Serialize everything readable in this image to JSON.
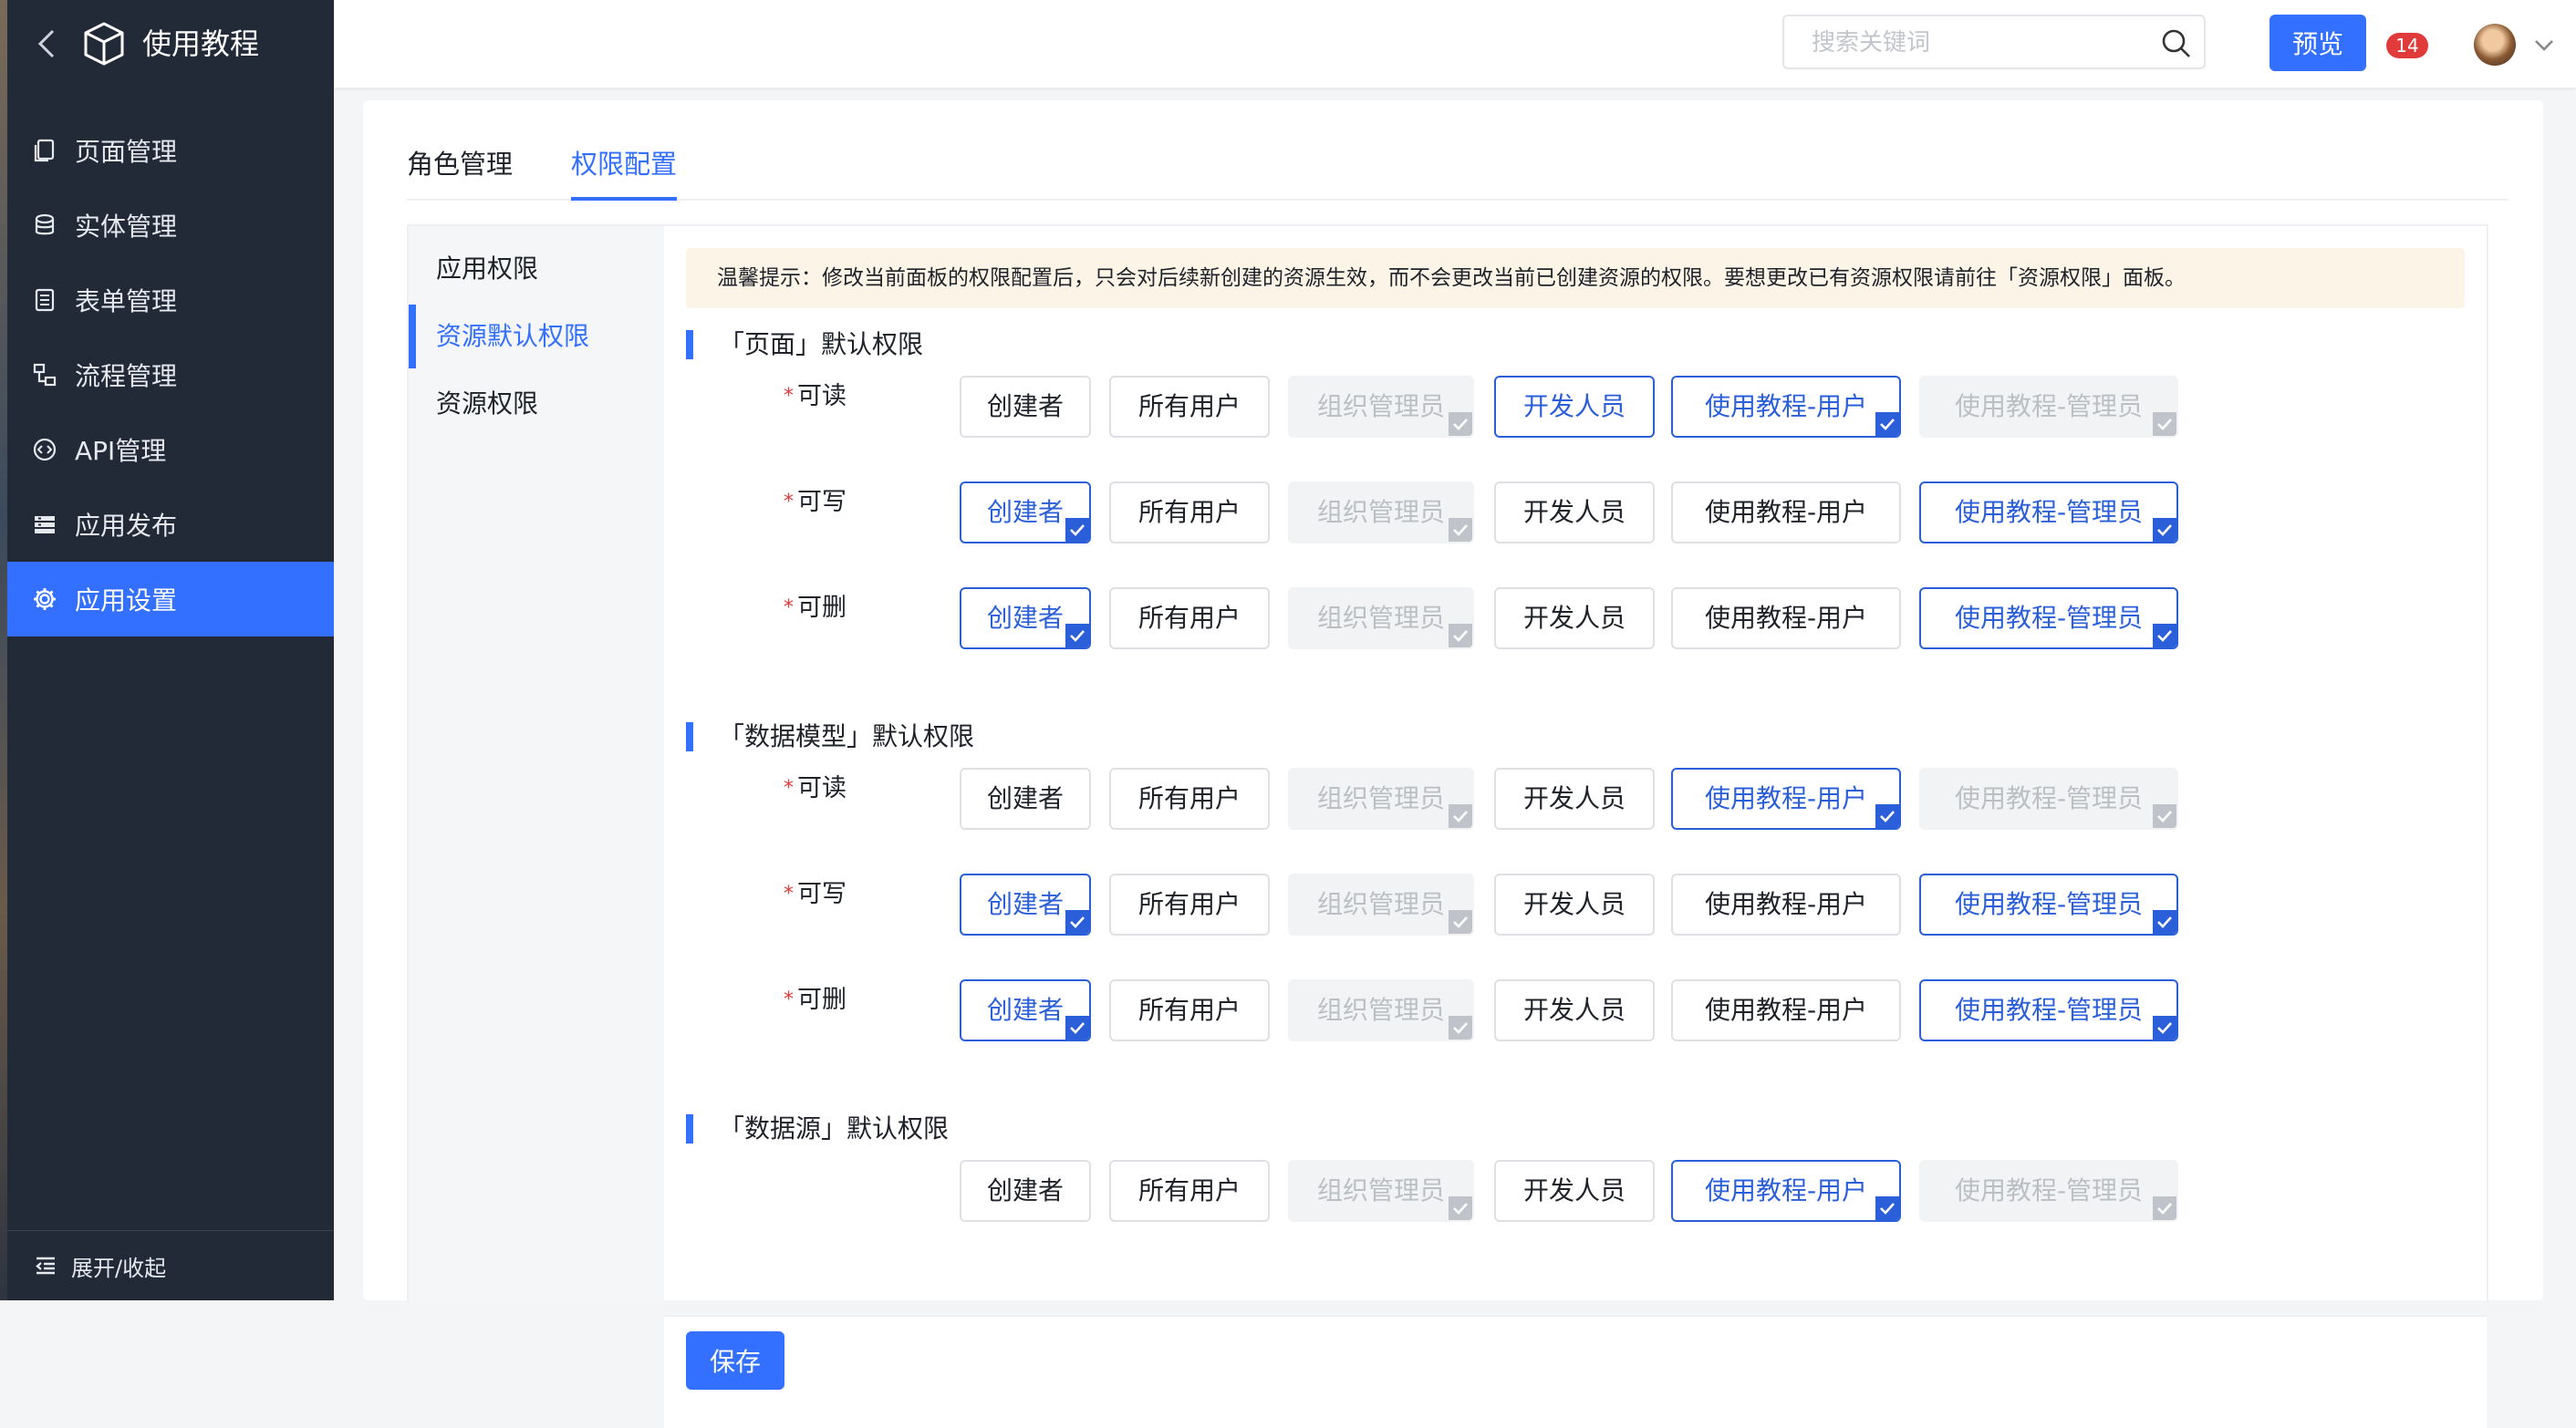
{
  "app": {
    "title": "使用教程"
  },
  "sidebar": {
    "items": [
      {
        "label": "页面管理",
        "icon": "page-icon"
      },
      {
        "label": "实体管理",
        "icon": "database-icon"
      },
      {
        "label": "表单管理",
        "icon": "form-icon"
      },
      {
        "label": "流程管理",
        "icon": "flow-icon"
      },
      {
        "label": "API管理",
        "icon": "api-icon"
      },
      {
        "label": "应用发布",
        "icon": "publish-icon"
      },
      {
        "label": "应用设置",
        "icon": "gear-icon",
        "active": true
      }
    ],
    "collapse_label": "展开/收起"
  },
  "header": {
    "search_placeholder": "搜索关键词",
    "preview_label": "预览",
    "badge_count": "14"
  },
  "tabs": [
    {
      "label": "角色管理"
    },
    {
      "label": "权限配置",
      "active": true
    }
  ],
  "subnav": [
    {
      "label": "应用权限"
    },
    {
      "label": "资源默认权限",
      "active": true
    },
    {
      "label": "资源权限"
    }
  ],
  "tip": "温馨提示：修改当前面板的权限配置后，只会对后续新创建的资源生效，而不会更改当前已创建资源的权限。要想更改已有资源权限请前往「资源权限」面板。",
  "options": [
    "创建者",
    "所有用户",
    "组织管理员",
    "开发人员",
    "使用教程-用户",
    "使用教程-管理员"
  ],
  "sections": [
    {
      "title": "「页面」默认权限",
      "rows": [
        {
          "label": "可读",
          "states": [
            "unchecked",
            "unchecked",
            "disabled",
            "checked-nocorner",
            "checked",
            "disabled"
          ]
        },
        {
          "label": "可写",
          "states": [
            "checked",
            "unchecked",
            "disabled",
            "unchecked",
            "unchecked",
            "checked"
          ]
        },
        {
          "label": "可删",
          "states": [
            "checked",
            "unchecked",
            "disabled",
            "unchecked",
            "unchecked",
            "checked"
          ]
        }
      ]
    },
    {
      "title": "「数据模型」默认权限",
      "rows": [
        {
          "label": "可读",
          "states": [
            "unchecked",
            "unchecked",
            "disabled",
            "unchecked",
            "checked",
            "disabled"
          ]
        },
        {
          "label": "可写",
          "states": [
            "checked",
            "unchecked",
            "disabled",
            "unchecked",
            "unchecked",
            "checked"
          ]
        },
        {
          "label": "可删",
          "states": [
            "checked",
            "unchecked",
            "disabled",
            "unchecked",
            "unchecked",
            "checked"
          ]
        }
      ]
    },
    {
      "title": "「数据源」默认权限",
      "rows": [
        {
          "label": "",
          "states": [
            "unchecked",
            "unchecked",
            "disabled",
            "unchecked",
            "checked",
            "disabled"
          ]
        }
      ]
    }
  ],
  "footer": {
    "save_label": "保存"
  },
  "colors": {
    "accent": "#3370ff",
    "sidebar": "#222a38",
    "checked": "#2b5fd9",
    "tip_bg": "#fdf4e8"
  }
}
